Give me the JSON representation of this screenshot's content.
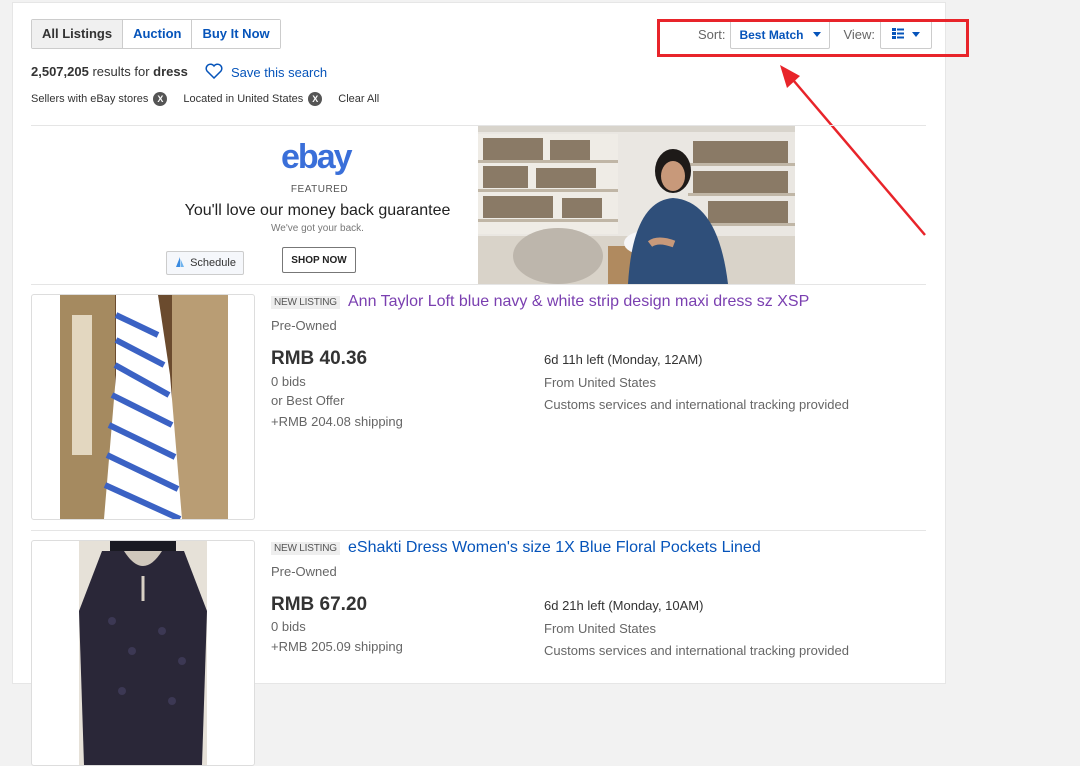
{
  "tabs": [
    "All Listings",
    "Auction",
    "Buy It Now"
  ],
  "results": {
    "count": "2,507,205",
    "for_text": "results for",
    "query": "dress"
  },
  "save_search": "Save this search",
  "filters": [
    {
      "label": "Sellers with eBay stores",
      "remove": "X"
    },
    {
      "label": "Located in United States",
      "remove": "X"
    }
  ],
  "clear_all": "Clear All",
  "sort": {
    "label": "Sort:",
    "value": "Best Match"
  },
  "view": {
    "label": "View:"
  },
  "ad": {
    "logo": [
      "e",
      "b",
      "a",
      "y"
    ],
    "logo_colors": [
      "#3a6fd9",
      "#3a6fd9",
      "#3a6fd9",
      "#3a6fd9"
    ],
    "featured": "FEATURED",
    "headline": "You'll love our money back guarantee",
    "subline": "We've got your back.",
    "schedule": "Schedule",
    "shop_now": "SHOP NOW"
  },
  "listings": [
    {
      "badge": "NEW LISTING",
      "title": "Ann Taylor Loft blue navy & white strip design maxi dress sz XSP",
      "condition": "Pre-Owned",
      "price": "RMB 40.36",
      "bids": "0 bids",
      "best_offer": "or Best Offer",
      "shipping": "+RMB 204.08 shipping",
      "time_left": "6d 11h left (Monday, 12AM)",
      "from": "From United States",
      "customs": "Customs services and international tracking provided"
    },
    {
      "badge": "NEW LISTING",
      "title": "eShakti Dress Women's size 1X Blue Floral Pockets Lined",
      "condition": "Pre-Owned",
      "price": "RMB 67.20",
      "bids": "0 bids",
      "shipping": "+RMB 205.09 shipping",
      "time_left": "6d 21h left (Monday, 10AM)",
      "from": "From United States",
      "customs": "Customs services and international tracking provided"
    }
  ],
  "colors": {
    "link": "#0654ba",
    "visited": "#7a3fb0",
    "annotation": "#e8242a"
  }
}
